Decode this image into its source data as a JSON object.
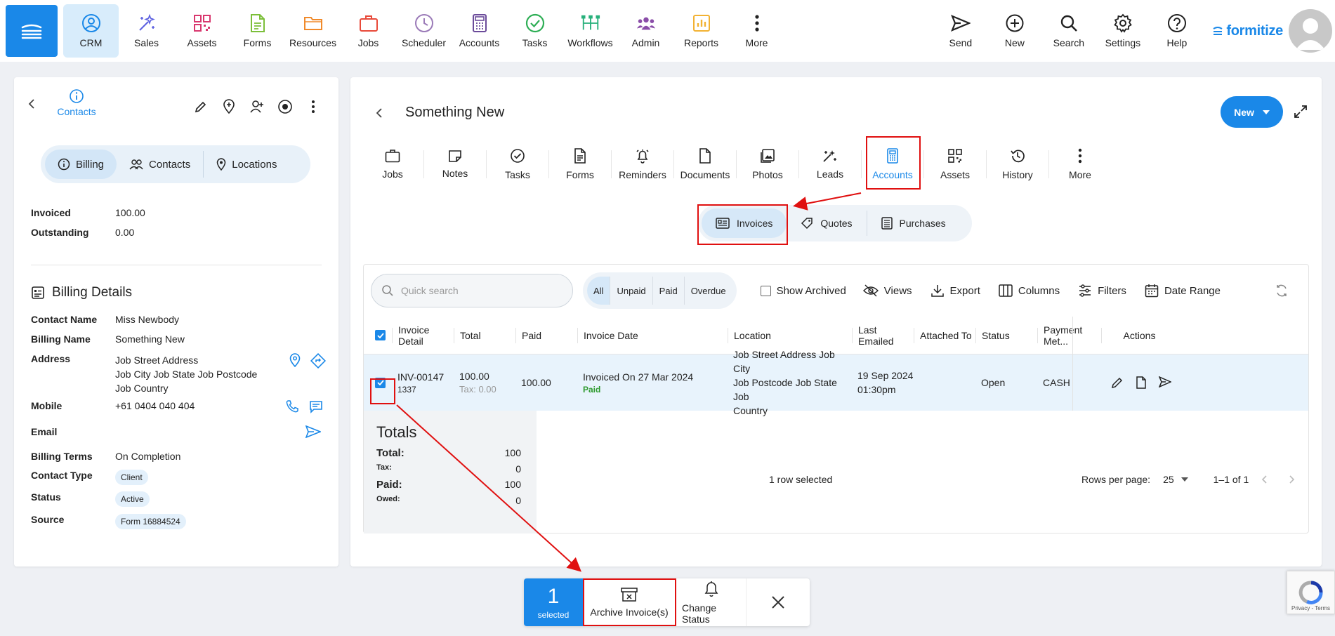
{
  "nav": {
    "items": [
      {
        "label": "CRM",
        "icon": "crm-icon",
        "color": "#1a88e8"
      },
      {
        "label": "Sales",
        "icon": "sparkle-icon",
        "color": "#5b5fe0"
      },
      {
        "label": "Assets",
        "icon": "qr-icon",
        "color": "#d9376e"
      },
      {
        "label": "Forms",
        "icon": "form-icon",
        "color": "#7cbf3a"
      },
      {
        "label": "Resources",
        "icon": "folder-icon",
        "color": "#f08a2b"
      },
      {
        "label": "Jobs",
        "icon": "briefcase-icon",
        "color": "#e84a3a"
      },
      {
        "label": "Scheduler",
        "icon": "clock-icon",
        "color": "#9b7bb8"
      },
      {
        "label": "Accounts",
        "icon": "calculator-icon",
        "color": "#6b4b9a"
      },
      {
        "label": "Tasks",
        "icon": "check-circle-icon",
        "color": "#2eae55"
      },
      {
        "label": "Workflows",
        "icon": "workflow-icon",
        "color": "#27b07b"
      },
      {
        "label": "Admin",
        "icon": "people-icon",
        "color": "#8a4da8"
      },
      {
        "label": "Reports",
        "icon": "chart-icon",
        "color": "#f2b233"
      },
      {
        "label": "More",
        "icon": "more-icon",
        "color": "#222222"
      }
    ],
    "right": [
      {
        "label": "Send",
        "icon": "send-icon"
      },
      {
        "label": "New",
        "icon": "plus-circle-icon"
      },
      {
        "label": "Search",
        "icon": "search-icon"
      },
      {
        "label": "Settings",
        "icon": "gear-icon"
      },
      {
        "label": "Help",
        "icon": "help-icon"
      }
    ],
    "brand": "formitize"
  },
  "left": {
    "header_label": "Contacts",
    "tabs": [
      "Billing",
      "Contacts",
      "Locations"
    ],
    "invoiced_label": "Invoiced",
    "invoiced_value": "100.00",
    "outstanding_label": "Outstanding",
    "outstanding_value": "0.00",
    "billing_title": "Billing Details",
    "contact_name_label": "Contact Name",
    "contact_name": "Miss Newbody",
    "billing_name_label": "Billing Name",
    "billing_name": "Something New",
    "address_label": "Address",
    "address_1": "Job Street Address",
    "address_2": "Job City Job State Job Postcode",
    "address_3": "Job Country",
    "mobile_label": "Mobile",
    "mobile": "+61 0404 040 404",
    "email_label": "Email",
    "terms_label": "Billing Terms",
    "terms": "On Completion",
    "type_label": "Contact Type",
    "type": "Client",
    "status_label": "Status",
    "status": "Active",
    "source_label": "Source",
    "source": "Form 16884524"
  },
  "main": {
    "title": "Something New",
    "new_label": "New",
    "tabs": [
      "Jobs",
      "Notes",
      "Tasks",
      "Forms",
      "Reminders",
      "Documents",
      "Photos",
      "Leads",
      "Accounts",
      "Assets",
      "History",
      "More"
    ],
    "subtabs": [
      "Invoices",
      "Quotes",
      "Purchases"
    ],
    "search_placeholder": "Quick search",
    "filters": [
      "All",
      "Unpaid",
      "Paid",
      "Overdue"
    ],
    "show_archived": "Show Archived",
    "views": "Views",
    "export": "Export",
    "columns": "Columns",
    "filters_label": "Filters",
    "date_range": "Date Range",
    "columns_list": [
      "Invoice Detail",
      "Total",
      "Paid",
      "Invoice Date",
      "Location",
      "Last Emailed",
      "Attached To",
      "Status",
      "Payment Met...",
      "Actions"
    ],
    "row": {
      "invoice": "INV-00147",
      "invoice_sub": "1337",
      "total": "100.00",
      "tax": "Tax: 0.00",
      "paid": "100.00",
      "date": "Invoiced On 27 Mar 2024",
      "date_sub": "Paid",
      "location_1": "Job Street Address Job City",
      "location_2": "Job Postcode Job State Job",
      "location_3": "Country",
      "emailed_1": "19 Sep 2024",
      "emailed_2": "01:30pm",
      "status": "Open",
      "payment": "CASH"
    },
    "totals": {
      "title": "Totals",
      "total_label": "Total:",
      "total": "100",
      "tax_label": "Tax:",
      "tax": "0",
      "paid_label": "Paid:",
      "paid": "100",
      "owed_label": "Owed:",
      "owed": "0"
    },
    "selected_text": "1 row selected",
    "rows_per_page_label": "Rows per page:",
    "rows_per_page": "25",
    "range": "1–1 of 1"
  },
  "bulk": {
    "count": "1",
    "count_label": "selected",
    "archive": "Archive Invoice(s)",
    "change_status": "Change Status"
  },
  "recaptcha": "Privacy - Terms",
  "colors": {
    "accent": "#1a88e8",
    "highlight": "#e01010"
  }
}
